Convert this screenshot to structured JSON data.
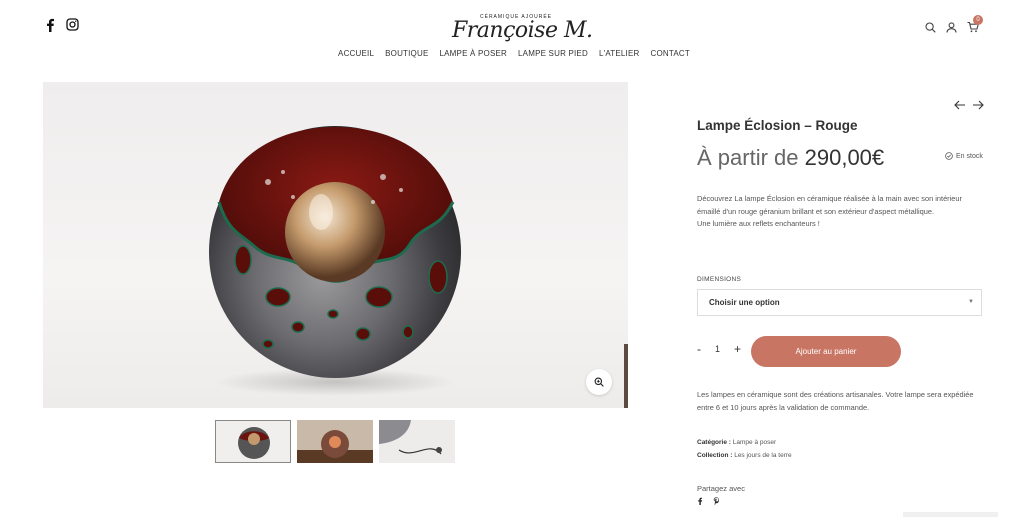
{
  "header": {
    "social_icons": [
      "facebook-icon",
      "instagram-icon"
    ],
    "logo_tagline": "CÉRAMIQUE AJOURÉE",
    "logo_script": "Françoise M.",
    "icons": [
      "search-icon",
      "user-icon",
      "cart-icon"
    ],
    "cart_count": "0"
  },
  "nav": {
    "items": [
      {
        "label": "ACCUEIL"
      },
      {
        "label": "BOUTIQUE"
      },
      {
        "label": "LAMPE À POSER"
      },
      {
        "label": "LAMPE SUR PIED"
      },
      {
        "label": "L'ATELIER"
      },
      {
        "label": "CONTACT"
      }
    ]
  },
  "gallery": {
    "zoom_icon": "zoom-icon",
    "thumbnail_count": 3
  },
  "product": {
    "title": "Lampe Éclosion – Rouge",
    "price_prefix": "À partir de",
    "price": "290,00€",
    "stock": "En stock",
    "description_1": "Découvrez La lampe Éclosion en céramique réalisée à la main avec son intérieur émaillé d'un rouge géranium brillant et son extérieur d'aspect métallique.",
    "description_2": "Une lumière aux reflets enchanteurs !",
    "option_label": "DIMENSIONS",
    "option_value": "Choisir une option",
    "qty_minus": "-",
    "qty_value": "1",
    "qty_plus": "+",
    "add_to_cart": "Ajouter au panier",
    "shipping_note": "Les lampes en céramique sont des créations artisanales. Votre lampe sera expédiée entre 6 et 10 jours après la validation de commande.",
    "category_label": "Catégorie :",
    "category_value": "Lampe à poser",
    "collection_label": "Collection :",
    "collection_value": "Les jours de la terre",
    "share_label": "Partagez avec"
  },
  "colors": {
    "accent": "#c87563",
    "text": "#333333"
  }
}
